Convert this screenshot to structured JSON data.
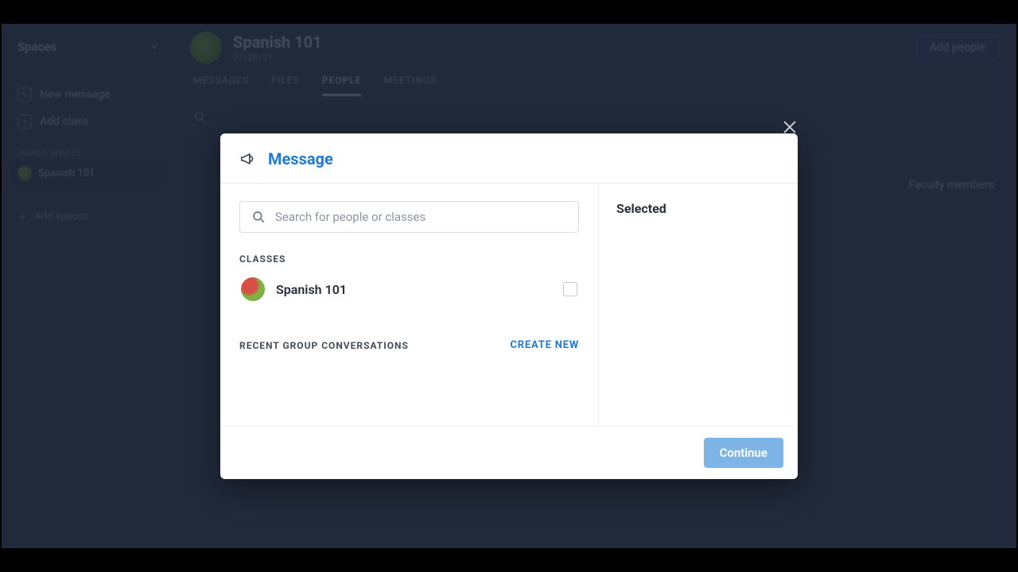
{
  "sidebar": {
    "spaces_label": "Spaces",
    "new_message": "New message",
    "add_class": "Add class",
    "section_joined": "JOINED SPACES",
    "class_name": "Spanish 101",
    "add_spaces": "Add spaces"
  },
  "header": {
    "title": "Spanish 101",
    "subtitle": "07/28/21",
    "add_people": "Add people"
  },
  "tabs": {
    "t1": "MESSAGES",
    "t2": "FILES",
    "t3": "PEOPLE",
    "t4": "MEETINGS"
  },
  "faculty_label": "Faculty members",
  "modal": {
    "title": "Message",
    "search_placeholder": "Search for people or classes",
    "classes_label": "CLASSES",
    "class1": "Spanish 101",
    "recent_label": "RECENT GROUP CONVERSATIONS",
    "create_new": "CREATE NEW",
    "selected_label": "Selected",
    "continue": "Continue"
  }
}
